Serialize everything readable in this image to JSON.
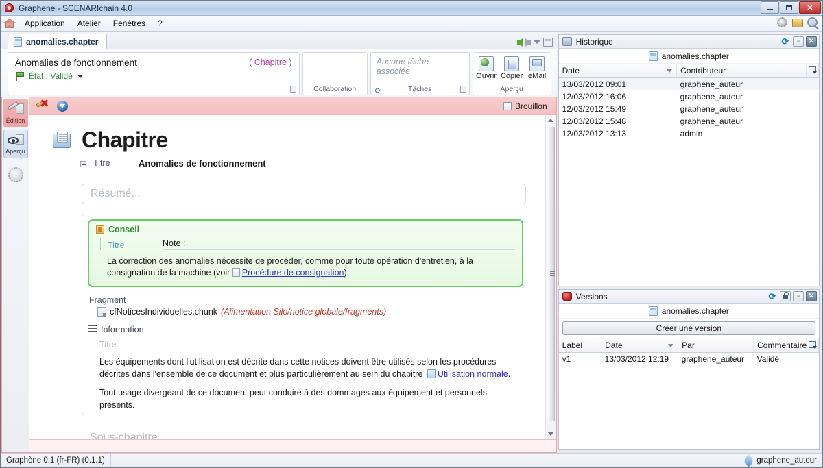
{
  "window": {
    "title": "Graphene - SCENARIchain 4.0",
    "icon": "app-logo-icon",
    "controls": {
      "minimize": "–",
      "maximize": "□",
      "close": "✕"
    }
  },
  "menubar": {
    "home_icon": "home-icon",
    "items": [
      "Application",
      "Atelier",
      "Fenêtres",
      "?"
    ],
    "right_icons": [
      "gear-icon",
      "folder-icon",
      "search-icon"
    ]
  },
  "tabs": {
    "items": [
      {
        "label": "anomalies.chapter",
        "icon": "document-icon",
        "active": true
      }
    ],
    "nav": {
      "back": "back-arrow-icon",
      "forward": "forward-arrow-icon",
      "dropdown": "chevron-down-icon",
      "restore": "restore-panel-icon"
    }
  },
  "ribbon": {
    "item_title": "Anomalies de fonctionnement",
    "item_type_open": "(",
    "item_type": "Chapitre",
    "item_type_close": ")",
    "state_label": "État : Validé",
    "groups": {
      "collaboration": {
        "label": "Collaboration"
      },
      "tasks": {
        "label": "Tâches",
        "empty_text": "Aucune tâche associée",
        "refresh_icon": "refresh-icon"
      },
      "preview": {
        "label": "Aperçu",
        "buttons": [
          {
            "label": "Ouvrir",
            "icon": "open-globe-icon"
          },
          {
            "label": "Copier",
            "icon": "copy-icon"
          },
          {
            "label": "eMail",
            "icon": "email-icon"
          }
        ]
      }
    }
  },
  "vtoolbar": {
    "items": [
      {
        "label": "Édition",
        "icon": "pencil-page-icon",
        "active": true
      },
      {
        "label": "Aperçu",
        "icon": "eye-page-icon",
        "active": false
      },
      {
        "label": "",
        "icon": "gear-icon",
        "active": false
      }
    ]
  },
  "editor": {
    "toolbar": {
      "delete_icon": "delete-item-icon",
      "download_icon": "download-icon",
      "draft_label": "Brouillon",
      "draft_checked": false
    },
    "heading": "Chapitre",
    "heading_icon": "chapter-icon",
    "title_field": {
      "label": "Titre",
      "value": "Anomalies de fonctionnement"
    },
    "summary_placeholder": "Résumé...",
    "conseil": {
      "block_label": "Conseil",
      "title_label": "Titre",
      "title_value": "Note :",
      "body_prefix": "La correction des anomalies nécessite de procéder, comme pour toute opération d'entretien, à la consignation de la machine (voir",
      "link_text": "Procédure de consignation",
      "body_suffix": ")."
    },
    "fragment": {
      "label": "Fragment",
      "name": "cfNoticesIndividuelles.chunk",
      "path": "(Alimentation Silo/notice globale/fragments)"
    },
    "information": {
      "label": "Information",
      "title_placeholder": "Titre",
      "para1_prefix": "Les équipements dont l'utilisation est décrite dans cette notices doivent être utilisés selon les procédures décrites dans l'ensemble de ce document et plus particulièrement au sein du chapitre",
      "para1_link": "Utilisation normale",
      "para1_suffix": ".",
      "para2": "Tout usage divergeant de ce document peut conduire à des dommages aux équipement et personnels présents."
    },
    "subchapter_placeholder": "Sous-chapitre..."
  },
  "historique": {
    "title": "Historique",
    "icon": "history-icon",
    "header_icons": [
      "sync-icon",
      "restore-icon",
      "close-icon"
    ],
    "document": "anomalies.chapter",
    "columns": [
      "Date",
      "Contributeur"
    ],
    "rows": [
      {
        "date": "13/03/2012 09:01",
        "contributeur": "graphene_auteur",
        "selected": true
      },
      {
        "date": "12/03/2012 16:06",
        "contributeur": "graphene_auteur",
        "selected": false
      },
      {
        "date": "12/03/2012 15:49",
        "contributeur": "graphene_auteur",
        "selected": false
      },
      {
        "date": "12/03/2012 15:48",
        "contributeur": "graphene_auteur",
        "selected": false
      },
      {
        "date": "12/03/2012 13:13",
        "contributeur": "admin",
        "selected": false
      }
    ]
  },
  "versions": {
    "title": "Versions",
    "icon": "versions-icon",
    "header_icons": [
      "sync-icon",
      "lock-icon",
      "restore-icon",
      "close-icon"
    ],
    "document": "anomalies.chapter",
    "create_button": "Créer une version",
    "columns": [
      "Label",
      "Date",
      "Par",
      "Commentaire"
    ],
    "rows": [
      {
        "label": "v1",
        "date": "13/03/2012 12:19",
        "par": "graphene_auteur",
        "commentaire": "Validé"
      }
    ]
  },
  "statusbar": {
    "left": "Graphène 0.1 (fr-FR) (0.1.1)",
    "user": "graphene_auteur",
    "user_icon": "user-icon"
  },
  "colors": {
    "accent_red": "#e8a0a0",
    "state_green": "#2f8f33",
    "type_magenta": "#b23fb2",
    "link_blue": "#3333cc",
    "fragment_red": "#c13c2c",
    "conseil_green": "#66cc66"
  }
}
